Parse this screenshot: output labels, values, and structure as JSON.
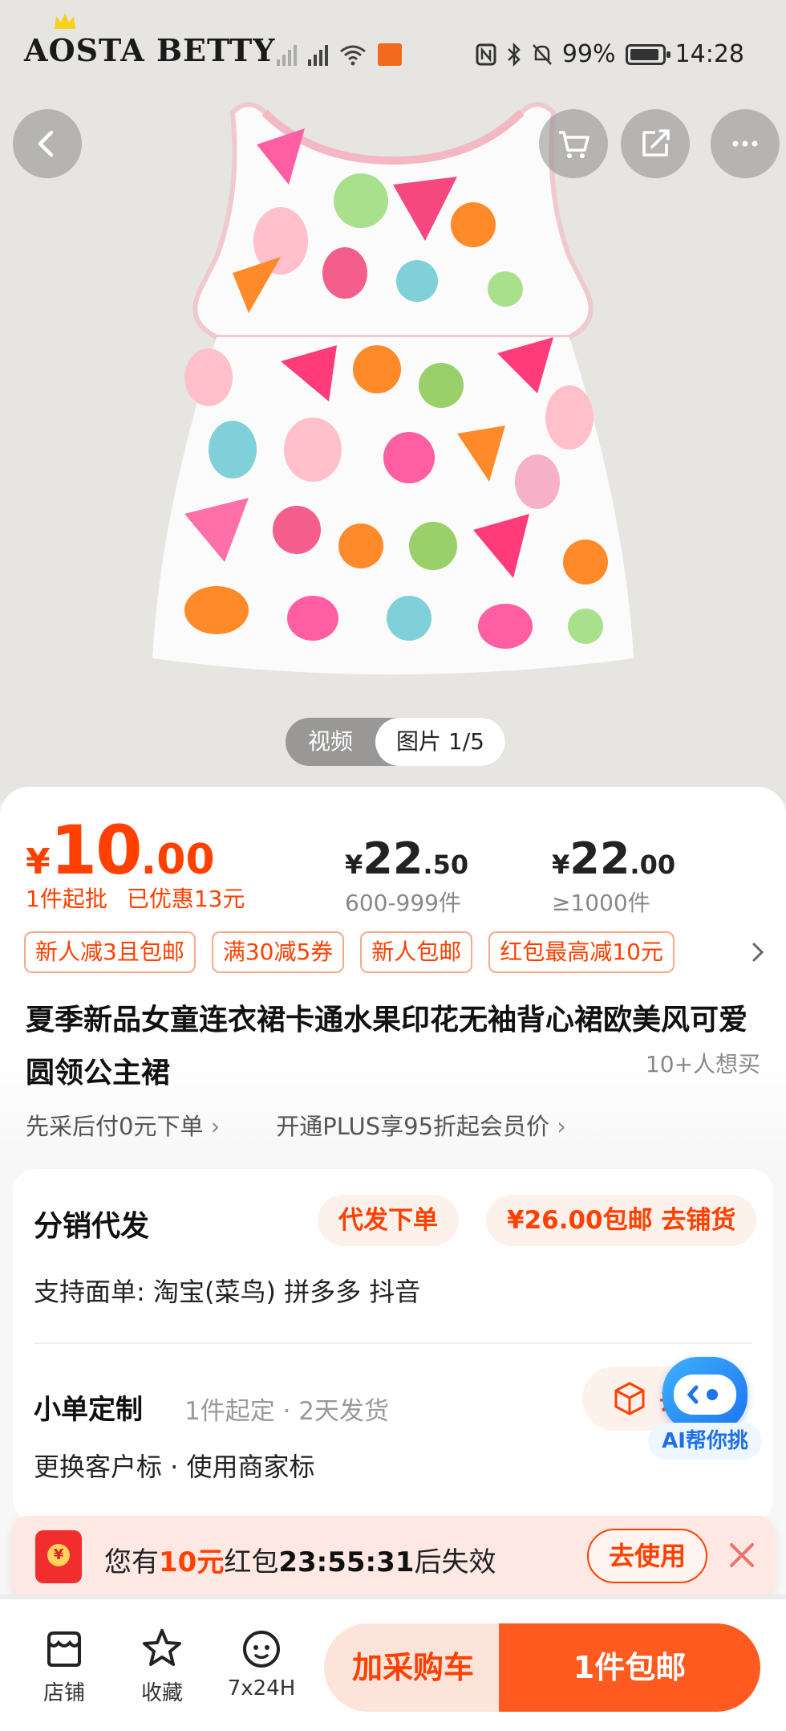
{
  "status_bar": {
    "brand": "AOSTA BETTY",
    "battery": "99%",
    "time": "14:28"
  },
  "header": {
    "back_icon": "chevron-left-icon",
    "cart_icon": "cart-icon",
    "share_icon": "share-icon",
    "more_icon": "more-icon"
  },
  "media": {
    "video_label": "视频",
    "image_label": "图片 1/5"
  },
  "price": {
    "currency": "¥",
    "main_int": "10",
    "main_dec": ".00",
    "min_order": "1件起批",
    "discount": "已优惠13元",
    "tiers": [
      {
        "currency": "¥",
        "int": "22",
        "dec": ".50",
        "qty": "600-999件"
      },
      {
        "currency": "¥",
        "int": "22",
        "dec": ".00",
        "qty": "≥1000件"
      }
    ]
  },
  "coupons": [
    "新人减3且包邮",
    "满30减5券",
    "新人包邮",
    "红包最高减10元"
  ],
  "product": {
    "title": "夏季新品女童连衣裙卡通水果印花无袖背心裙欧美风可爱圆领公主裙",
    "want_count": "10+人想买"
  },
  "services": {
    "pay_later": "先采后付0元下单",
    "plus": "开通PLUS享95折起会员价"
  },
  "distribution": {
    "title": "分销代发",
    "proxy_btn": "代发下单",
    "stock_btn": "¥26.00包邮 去铺货",
    "support": "支持面单:  淘宝(菜鸟) 拼多多 抖音"
  },
  "custom": {
    "title": "小单定制",
    "meta": "1件起定 · 2天发货",
    "options": "更换客户标  ·  使用商家标",
    "btn": "去"
  },
  "ai_bot": {
    "label": "AI帮你挑"
  },
  "packet": {
    "prefix": "您有",
    "amount": "10元",
    "mid": "红包",
    "timer": "23:55:31",
    "suffix": "后失效",
    "use_btn": "去使用"
  },
  "bottom_bar": {
    "shop": "店铺",
    "favorite": "收藏",
    "service": "7x24H",
    "add_cart": "加采购车",
    "buy": "1件包邮"
  },
  "colors": {
    "accent": "#ff4000",
    "buy_button": "#ff5a1f",
    "cart_button_bg": "#fde4da"
  }
}
